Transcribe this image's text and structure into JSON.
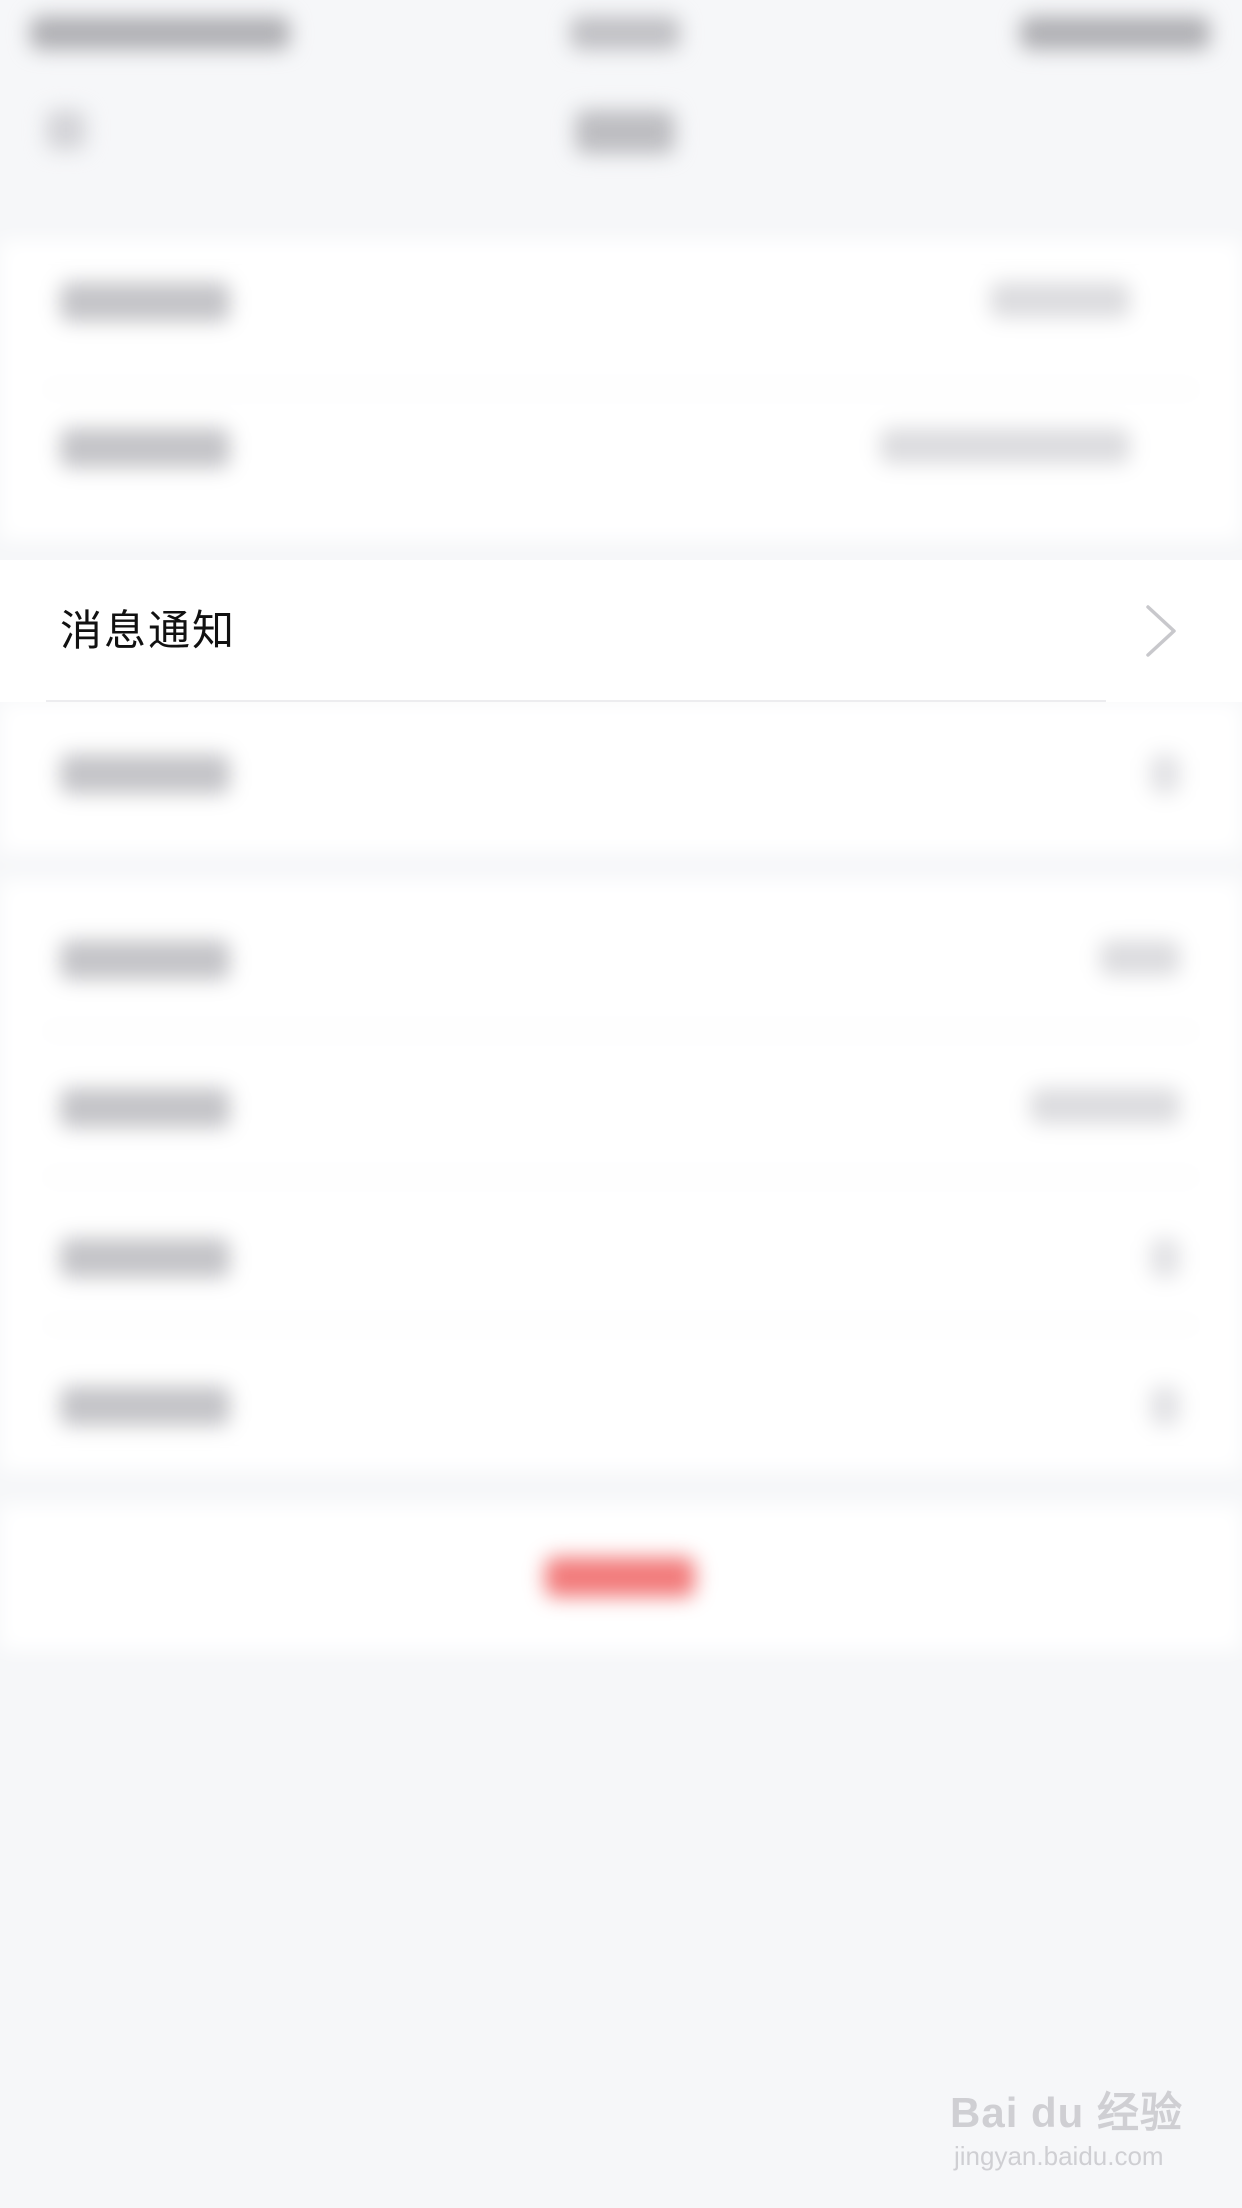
{
  "focused_row": {
    "label": "消息通知",
    "icon": "chevron-right-icon"
  },
  "watermark": {
    "brand": "Bai du 经验",
    "url": "jingyan.baidu.com"
  },
  "colors": {
    "background": "#f6f7f9",
    "row_background": "#ffffff",
    "text": "#111111",
    "chevron": "#c8c8cc",
    "destructive_button_blurred": "#f27b7b"
  }
}
